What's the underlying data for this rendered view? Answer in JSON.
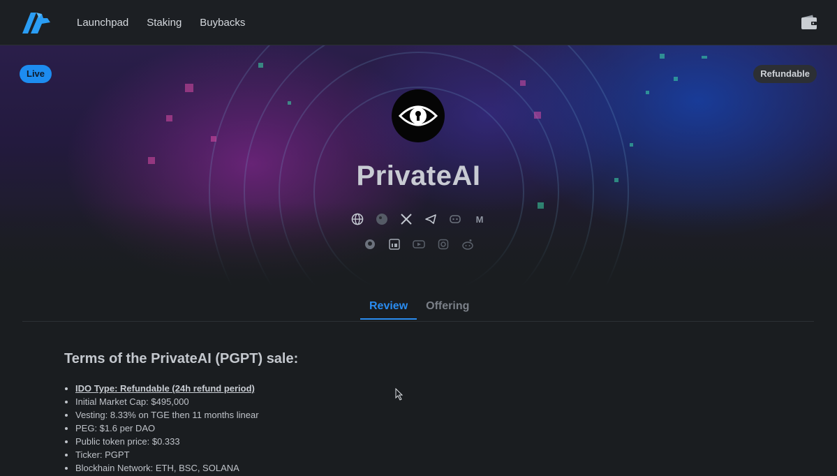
{
  "nav": {
    "items": [
      "Launchpad",
      "Staking",
      "Buybacks"
    ]
  },
  "hero": {
    "status_badge": "Live",
    "type_badge": "Refundable",
    "project_name": "PrivateAI",
    "social_icons_row1": [
      "globe-icon",
      "coingecko-icon",
      "x-icon",
      "telegram-icon",
      "discord-icon",
      "medium-icon"
    ],
    "social_icons_row2": [
      "github-icon",
      "linkedin-icon",
      "youtube-icon",
      "instagram-icon",
      "reddit-icon"
    ],
    "medium_glyph": "M"
  },
  "tabs": [
    "Review",
    "Offering"
  ],
  "terms": {
    "title": "Terms of the PrivateAI (PGPT) sale:",
    "items": [
      "IDO Type: Refundable (24h refund period)",
      "Initial Market Cap: $495,000",
      "Vesting: 8.33% on TGE then 11 months linear",
      "PEG: $1.6 per DAO",
      "Public token price: $0.333",
      "Ticker: PGPT",
      "Blockhain Network: ETH, BSC, SOLANA"
    ]
  },
  "colors": {
    "accent": "#1d8cf0",
    "background": "#1a1d20",
    "topbar": "#1c1f23"
  }
}
